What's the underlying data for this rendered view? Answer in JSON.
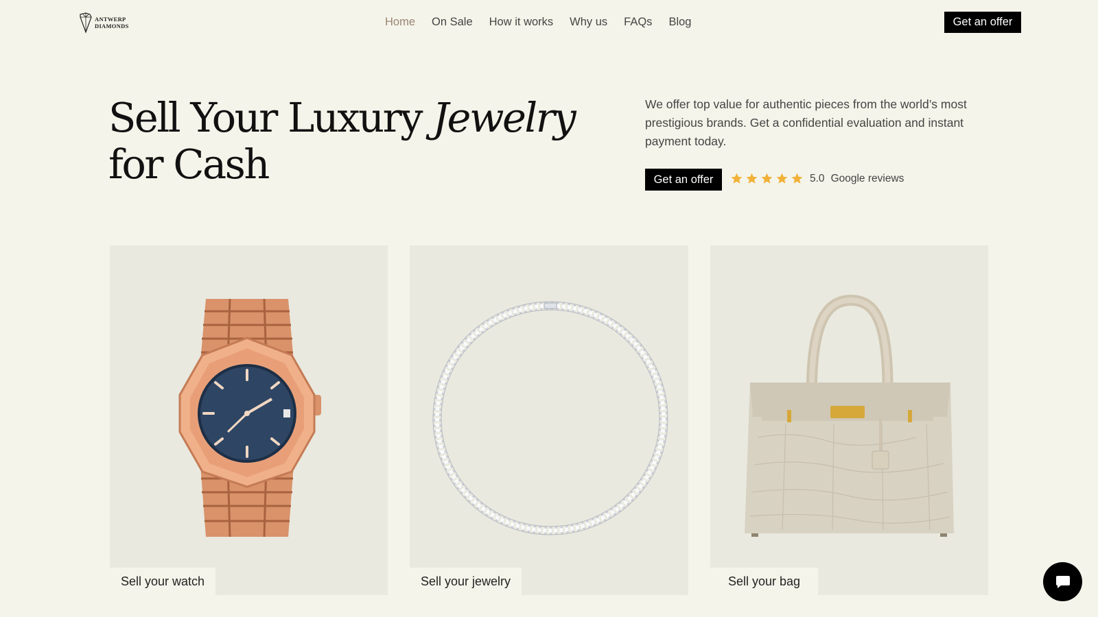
{
  "header": {
    "logo_lines": [
      "ANTWERP",
      "DIAMONDS"
    ],
    "logo_icon": "diamond-logo-icon",
    "nav": [
      {
        "label": "Home",
        "active": true
      },
      {
        "label": "On Sale",
        "active": false
      },
      {
        "label": "How it works",
        "active": false
      },
      {
        "label": "Why us",
        "active": false
      },
      {
        "label": "FAQs",
        "active": false
      },
      {
        "label": "Blog",
        "active": false
      }
    ],
    "cta_label": "Get an offer"
  },
  "hero": {
    "title_part1": "Sell Your Luxury ",
    "title_italic": "Jewelry",
    "title_part2": "for Cash",
    "description": "We offer top value for authentic pieces from the world’s most prestigious brands. Get a confidential evaluation and instant payment today.",
    "cta_label": "Get an offer",
    "rating": {
      "stars": 5,
      "score": "5.0",
      "source": "Google reviews"
    }
  },
  "cards": [
    {
      "label": "Sell your watch",
      "image": "gold-watch"
    },
    {
      "label": "Sell your jewelry",
      "image": "diamond-necklace"
    },
    {
      "label": "Sell your bag",
      "image": "beige-handbag"
    }
  ],
  "chat": {
    "icon": "chat-bubble-icon"
  },
  "colors": {
    "background": "#f4f4ea",
    "card_background": "#e9e9df",
    "accent_nav": "#9a8573",
    "button": "#000000",
    "star": "#f2b138"
  }
}
